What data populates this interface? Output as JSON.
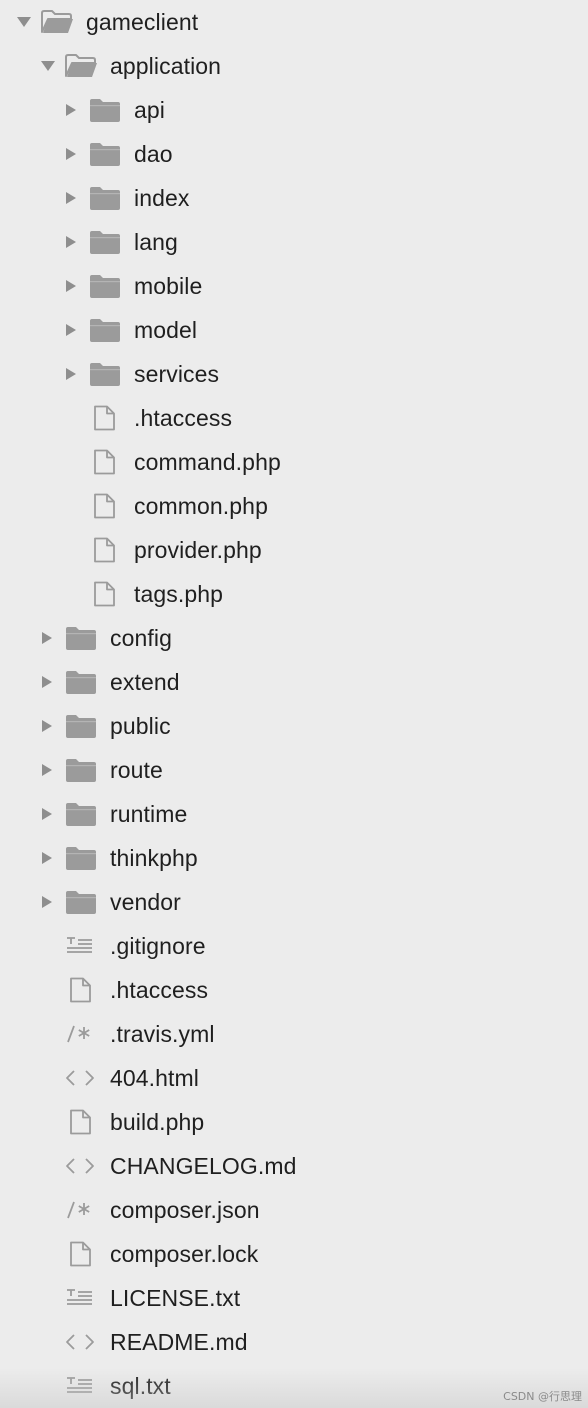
{
  "tree": [
    {
      "label": "gameclient",
      "type": "folder",
      "expanded": true,
      "depth": 0
    },
    {
      "label": "application",
      "type": "folder",
      "expanded": true,
      "depth": 1
    },
    {
      "label": "api",
      "type": "folder",
      "expanded": false,
      "depth": 2
    },
    {
      "label": "dao",
      "type": "folder",
      "expanded": false,
      "depth": 2
    },
    {
      "label": "index",
      "type": "folder",
      "expanded": false,
      "depth": 2
    },
    {
      "label": "lang",
      "type": "folder",
      "expanded": false,
      "depth": 2
    },
    {
      "label": "mobile",
      "type": "folder",
      "expanded": false,
      "depth": 2
    },
    {
      "label": "model",
      "type": "folder",
      "expanded": false,
      "depth": 2
    },
    {
      "label": "services",
      "type": "folder",
      "expanded": false,
      "depth": 2
    },
    {
      "label": ".htaccess",
      "type": "file",
      "depth": 2
    },
    {
      "label": "command.php",
      "type": "file",
      "depth": 2
    },
    {
      "label": "common.php",
      "type": "file",
      "depth": 2
    },
    {
      "label": "provider.php",
      "type": "file",
      "depth": 2
    },
    {
      "label": "tags.php",
      "type": "file",
      "depth": 2
    },
    {
      "label": "config",
      "type": "folder",
      "expanded": false,
      "depth": 1
    },
    {
      "label": "extend",
      "type": "folder",
      "expanded": false,
      "depth": 1
    },
    {
      "label": "public",
      "type": "folder",
      "expanded": false,
      "depth": 1
    },
    {
      "label": "route",
      "type": "folder",
      "expanded": false,
      "depth": 1
    },
    {
      "label": "runtime",
      "type": "folder",
      "expanded": false,
      "depth": 1
    },
    {
      "label": "thinkphp",
      "type": "folder",
      "expanded": false,
      "depth": 1
    },
    {
      "label": "vendor",
      "type": "folder",
      "expanded": false,
      "depth": 1
    },
    {
      "label": ".gitignore",
      "type": "text",
      "depth": 1
    },
    {
      "label": ".htaccess",
      "type": "file",
      "depth": 1
    },
    {
      "label": ".travis.yml",
      "type": "comment",
      "depth": 1
    },
    {
      "label": "404.html",
      "type": "code",
      "depth": 1
    },
    {
      "label": "build.php",
      "type": "file",
      "depth": 1
    },
    {
      "label": "CHANGELOG.md",
      "type": "code",
      "depth": 1
    },
    {
      "label": "composer.json",
      "type": "comment",
      "depth": 1
    },
    {
      "label": "composer.lock",
      "type": "file",
      "depth": 1
    },
    {
      "label": "LICENSE.txt",
      "type": "text",
      "depth": 1
    },
    {
      "label": "README.md",
      "type": "code",
      "depth": 1
    },
    {
      "label": "sql.txt",
      "type": "text",
      "depth": 1
    }
  ],
  "watermark": "CSDN @行思理",
  "colors": {
    "background": "#ececec",
    "icon": "#9b9b9b",
    "disclosure": "#8e8e8e",
    "text": "#1f1f1f"
  },
  "icon_names": {
    "folder": "folder-icon",
    "folder_open": "folder-open-icon",
    "file": "file-icon",
    "text": "text-lines-icon",
    "comment": "comment-code-icon",
    "code": "code-brackets-icon",
    "expanded": "chevron-down-icon",
    "collapsed": "chevron-right-icon"
  }
}
